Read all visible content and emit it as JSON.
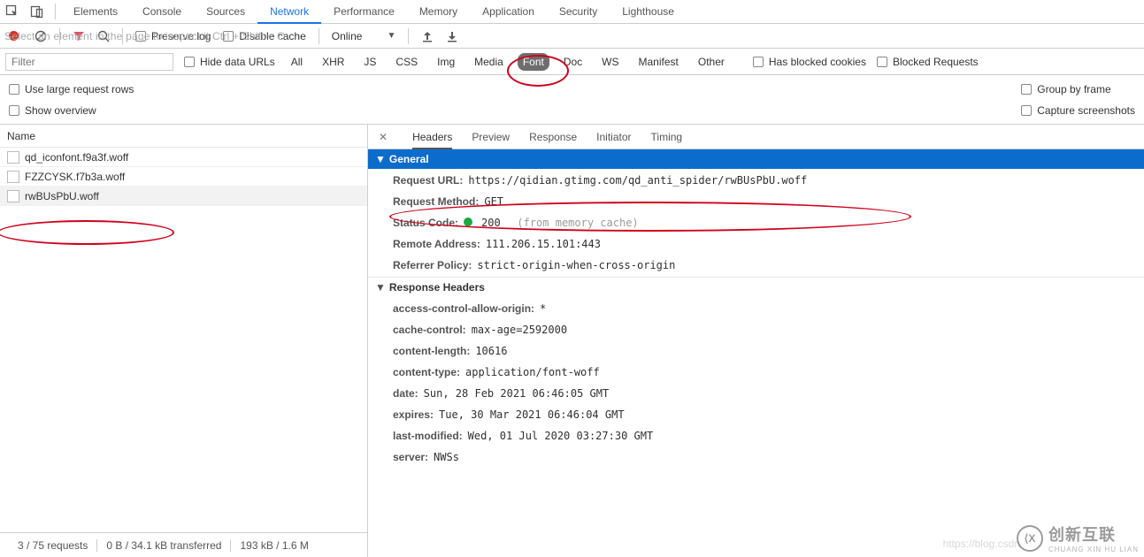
{
  "topTabs": [
    "Elements",
    "Console",
    "Sources",
    "Network",
    "Performance",
    "Memory",
    "Application",
    "Security",
    "Lighthouse"
  ],
  "topActive": "Network",
  "inspectHint": "Select an element in the page to inspect it   Ctrl + Shift + C",
  "toolbar": {
    "preserve": "Preserve log",
    "disable": "Disable cache",
    "online": "Online"
  },
  "filter": {
    "placeholder": "Filter",
    "hideUrls": "Hide data URLs",
    "types": [
      "All",
      "XHR",
      "JS",
      "CSS",
      "Img",
      "Media",
      "Font",
      "Doc",
      "WS",
      "Manifest",
      "Other"
    ],
    "selected": "Font",
    "hasBlocked": "Has blocked cookies",
    "blockedReq": "Blocked Requests"
  },
  "opts": {
    "large": "Use large request rows",
    "overview": "Show overview",
    "group": "Group by frame",
    "capture": "Capture screenshots"
  },
  "nameHeader": "Name",
  "files": [
    "qd_iconfont.f9a3f.woff",
    "FZZCYSK.f7b3a.woff",
    "rwBUsPbU.woff"
  ],
  "selectedFile": "rwBUsPbU.woff",
  "detailTabs": [
    "Headers",
    "Preview",
    "Response",
    "Initiator",
    "Timing"
  ],
  "detailActive": "Headers",
  "sections": {
    "general": "General",
    "resp": "Response Headers"
  },
  "general": {
    "requestUrlK": "Request URL:",
    "requestUrlV": "https://qidian.gtimg.com/qd_anti_spider/rwBUsPbU.woff",
    "methodK": "Request Method:",
    "methodV": "GET",
    "statusK": "Status Code:",
    "statusV": "200",
    "statusExtra": "(from memory cache)",
    "remoteK": "Remote Address:",
    "remoteV": "111.206.15.101:443",
    "refK": "Referrer Policy:",
    "refV": "strict-origin-when-cross-origin"
  },
  "resp": {
    "acaoK": "access-control-allow-origin:",
    "acaoV": "*",
    "ccK": "cache-control:",
    "ccV": "max-age=2592000",
    "clK": "content-length:",
    "clV": "10616",
    "ctK": "content-type:",
    "ctV": "application/font-woff",
    "dateK": "date:",
    "dateV": "Sun, 28 Feb 2021 06:46:05 GMT",
    "expK": "expires:",
    "expV": "Tue, 30 Mar 2021 06:46:04 GMT",
    "lmK": "last-modified:",
    "lmV": "Wed, 01 Jul 2020 03:27:30 GMT",
    "srvK": "server:",
    "srvV": "NWSs"
  },
  "status": {
    "req": "3 / 75 requests",
    "trans": "0 B / 34.1 kB transferred",
    "res": "193 kB / 1.6 M"
  },
  "watermark": {
    "zh": "创新互联",
    "en": "CHUANG XIN HU LIAN",
    "blog": "https://blog.csdn"
  }
}
